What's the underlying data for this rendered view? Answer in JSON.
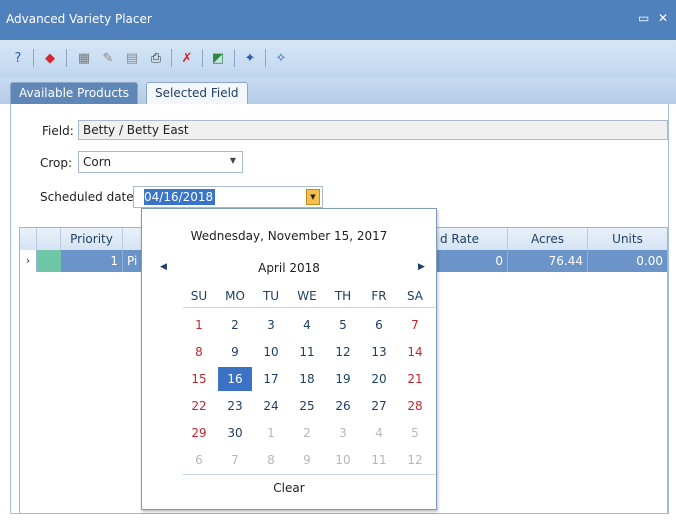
{
  "window": {
    "title": "Advanced Variety Placer",
    "buttons": [
      {
        "name": "restore",
        "glyph": "▭"
      },
      {
        "name": "close",
        "glyph": "✕"
      }
    ]
  },
  "toolbar": {
    "tools": [
      {
        "name": "help-icon",
        "glyph": "?",
        "color": "#2f5fa8"
      },
      {
        "name": "place-variety-icon",
        "glyph": "◆",
        "color": "#d7262f"
      },
      {
        "name": "add-field-icon",
        "glyph": "▦",
        "color": "#7a7a7a"
      },
      {
        "name": "seed-icon",
        "glyph": "✎",
        "color": "#8a8a8a"
      },
      {
        "name": "edit-field-icon",
        "glyph": "▤",
        "color": "#8a8a8a"
      },
      {
        "name": "print-icon",
        "glyph": "⎙",
        "color": "#333333"
      },
      {
        "name": "remove-icon",
        "glyph": "✗",
        "color": "#d7262f"
      },
      {
        "name": "field-report-icon",
        "glyph": "◩",
        "color": "#2e8b3e"
      },
      {
        "name": "pin-icon",
        "glyph": "✦",
        "color": "#2f5fa8"
      },
      {
        "name": "unpin-icon",
        "glyph": "✧",
        "color": "#2f5fa8"
      }
    ]
  },
  "tabs": [
    {
      "label": "Available Products",
      "active": false
    },
    {
      "label": "Selected Field",
      "active": true
    }
  ],
  "form": {
    "field_label": "Field:",
    "field_value": "Betty / Betty East",
    "crop_label": "Crop:",
    "crop_value": "Corn",
    "date_label": "Scheduled date:",
    "date_value": "04/16/2018"
  },
  "grid": {
    "columns": [
      "Priority",
      "Seed Rate",
      "Acres",
      "Units"
    ],
    "visible_headers": [
      "Priority",
      "d Rate",
      "Acres",
      "Units"
    ],
    "rows": [
      {
        "priority": "1",
        "product_partial": "Pi",
        "seed_rate": "0",
        "acres": "76.44",
        "units": "0.00"
      }
    ]
  },
  "calendar": {
    "today_text": "Wednesday, November 15, 2017",
    "month_label": "April 2018",
    "days_of_week": [
      "SU",
      "MO",
      "TU",
      "WE",
      "TH",
      "FR",
      "SA"
    ],
    "weeks": [
      [
        "1",
        "2",
        "3",
        "4",
        "5",
        "6",
        "7"
      ],
      [
        "8",
        "9",
        "10",
        "11",
        "12",
        "13",
        "14"
      ],
      [
        "15",
        "16",
        "17",
        "18",
        "19",
        "20",
        "21"
      ],
      [
        "22",
        "23",
        "24",
        "25",
        "26",
        "27",
        "28"
      ],
      [
        "29",
        "30",
        "1",
        "2",
        "3",
        "4",
        "5"
      ],
      [
        "6",
        "7",
        "8",
        "9",
        "10",
        "11",
        "12"
      ]
    ],
    "selected_day": "16",
    "clear_label": "Clear",
    "colors": {
      "weekend": "#c0262d",
      "other_month": "#b7b7b7",
      "selected_bg": "#3b72c4"
    }
  }
}
